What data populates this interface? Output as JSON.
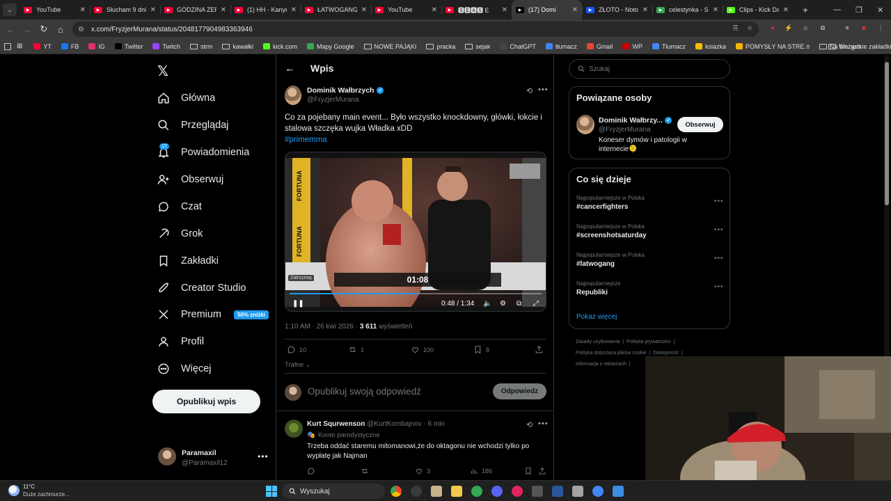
{
  "browser": {
    "tabs": [
      {
        "title": "YouTube",
        "favicon_color": "#ff0033",
        "active": false
      },
      {
        "title": "Słucham 9 dni",
        "favicon_color": "#ff0033",
        "active": false
      },
      {
        "title": "GODZINA ZER",
        "favicon_color": "#ff0033",
        "active": false
      },
      {
        "title": "(1) HH - Kanye",
        "favicon_color": "#ff0033",
        "active": false
      },
      {
        "title": "ŁATWOGANG",
        "favicon_color": "#ff0033",
        "active": false
      },
      {
        "title": "YouTube",
        "favicon_color": "#ff0033",
        "active": false
      },
      {
        "title": "🆂🅴🅰🆂 E",
        "favicon_color": "#ff0033",
        "active": false
      },
      {
        "title": "(17) Domi",
        "favicon_color": "#000000",
        "active": true
      },
      {
        "title": "ZŁOTO - Noto",
        "favicon_color": "#1a56ff",
        "active": false
      },
      {
        "title": "celestynka - S",
        "favicon_color": "#34a853",
        "active": false
      },
      {
        "title": "Clips - Kick Da",
        "favicon_color": "#53fc18",
        "active": false
      }
    ],
    "url": "x.com/FryzjerMurana/status/2048177904983363946",
    "bookmarks": [
      {
        "label": "YT",
        "icon": "youtube-icon"
      },
      {
        "label": "FB",
        "icon": "facebook-icon"
      },
      {
        "label": "IG",
        "icon": "instagram-icon"
      },
      {
        "label": "Twitter",
        "icon": "x-icon"
      },
      {
        "label": "Twitch",
        "icon": "twitch-icon"
      },
      {
        "label": "strm",
        "icon": "folder-icon"
      },
      {
        "label": "kawałki",
        "icon": "folder-icon"
      },
      {
        "label": "kick.com",
        "icon": "kick-icon"
      },
      {
        "label": "Mapy Google",
        "icon": "maps-icon"
      },
      {
        "label": "NOWE PAJĄKI",
        "icon": "folder-icon"
      },
      {
        "label": "pracka",
        "icon": "folder-icon"
      },
      {
        "label": "sejak",
        "icon": "folder-icon"
      },
      {
        "label": "ChatGPT",
        "icon": "chatgpt-icon"
      },
      {
        "label": "tłumacz",
        "icon": "translate-icon"
      },
      {
        "label": "Gmail",
        "icon": "gmail-icon"
      },
      {
        "label": "WP",
        "icon": "wp-icon"
      },
      {
        "label": "Tłumacz",
        "icon": "translate-icon"
      },
      {
        "label": "ksiazka",
        "icon": "apps-icon"
      },
      {
        "label": "POMYSŁY NA STRE...",
        "icon": "docs-icon"
      },
      {
        "label": "Na bieżąco",
        "icon": "folder-icon"
      }
    ],
    "all_bookmarks": "Wszystkie zakładki"
  },
  "nav": {
    "items": [
      {
        "label": "Główna",
        "icon": "home-icon"
      },
      {
        "label": "Przeglądaj",
        "icon": "search-icon"
      },
      {
        "label": "Powiadomienia",
        "icon": "bell-icon"
      },
      {
        "label": "Obserwuj",
        "icon": "add-person-icon"
      },
      {
        "label": "Czat",
        "icon": "chat-icon"
      },
      {
        "label": "Grok",
        "icon": "grok-icon"
      },
      {
        "label": "Zakładki",
        "icon": "bookmark-icon"
      },
      {
        "label": "Creator Studio",
        "icon": "rocket-icon"
      },
      {
        "label": "Premium",
        "icon": "x-icon"
      },
      {
        "label": "Profil",
        "icon": "person-icon"
      },
      {
        "label": "Więcej",
        "icon": "more-circle-icon"
      }
    ],
    "notifications_count": "17",
    "premium_promo": "50% zniżki",
    "post_button": "Opublikuj wpis",
    "account": {
      "name": "Paramaxil",
      "handle": "@Paramaxil12"
    }
  },
  "post": {
    "header_title": "Wpis",
    "author_name": "Dominik Wałbrzych",
    "author_handle": "@FryzjerMurana",
    "text": "Co za pojebany main event... Było wszystko knockdowny, główki, łokcie i stalowa szczęka wujka Władka xDD",
    "hashtag": "#primemma",
    "video": {
      "time": "0:48 / 1:34",
      "pause_tooltip": "Zatrzymaj",
      "scoreboard_time": "01:08",
      "progress": 0.51
    },
    "timestamp": "1:10 AM · 26 kwi 2026 · ",
    "views_count": "3 611",
    "views_label": " wyświetleń",
    "stats": {
      "replies": "10",
      "reposts": "1",
      "likes": "100",
      "bookmarks": "8"
    },
    "sort_label": "Trafne",
    "reply_placeholder": "Opublikuj swoją odpowiedź",
    "reply_button": "Odpowiedz"
  },
  "comment": {
    "author_name": "Kurt Squrwenson",
    "author_handle": "@KurtKombajnov",
    "time": " · 6 min",
    "parody_label": "Konto parodystyczne",
    "text": "Trzeba oddać staremu mitomanowi,że do oktagonu nie wchodzi tylko po wypłatę jak Najman",
    "stats": {
      "replies": "",
      "reposts": "",
      "likes": "3",
      "views": "186"
    }
  },
  "right": {
    "search_placeholder": "Szukaj",
    "related_title": "Powiązane osoby",
    "related": {
      "name": "Dominik Wałbrzy...",
      "handle": "@FryzjerMurana",
      "bio": "Koneser dymów i patologii w internecie🫠",
      "follow": "Obserwuj"
    },
    "trends_title": "Co się dzieje",
    "trends": [
      {
        "context": "Najpopularniejsze w Polska",
        "tag": "#cancerfighters"
      },
      {
        "context": "Najpopularniejsze w Polska",
        "tag": "#screenshotsaturday"
      },
      {
        "context": "Najpopularniejsze w Polska",
        "tag": "#latwogang"
      },
      {
        "context": "Najpopularniejsze",
        "tag": "Republiki"
      }
    ],
    "show_more": "Pokaż więcej",
    "footer_line1": [
      "Zasady użytkowania",
      "Polityka prywatności"
    ],
    "footer_line2": [
      "Polityka dotycząca plików cookie",
      "Dostępność"
    ],
    "footer_line3": [
      "Informacja o reklamach"
    ]
  },
  "taskbar": {
    "weather_temp": "11°C",
    "weather_desc": "Duże zachmurze...",
    "search": "Wyszukaj"
  }
}
